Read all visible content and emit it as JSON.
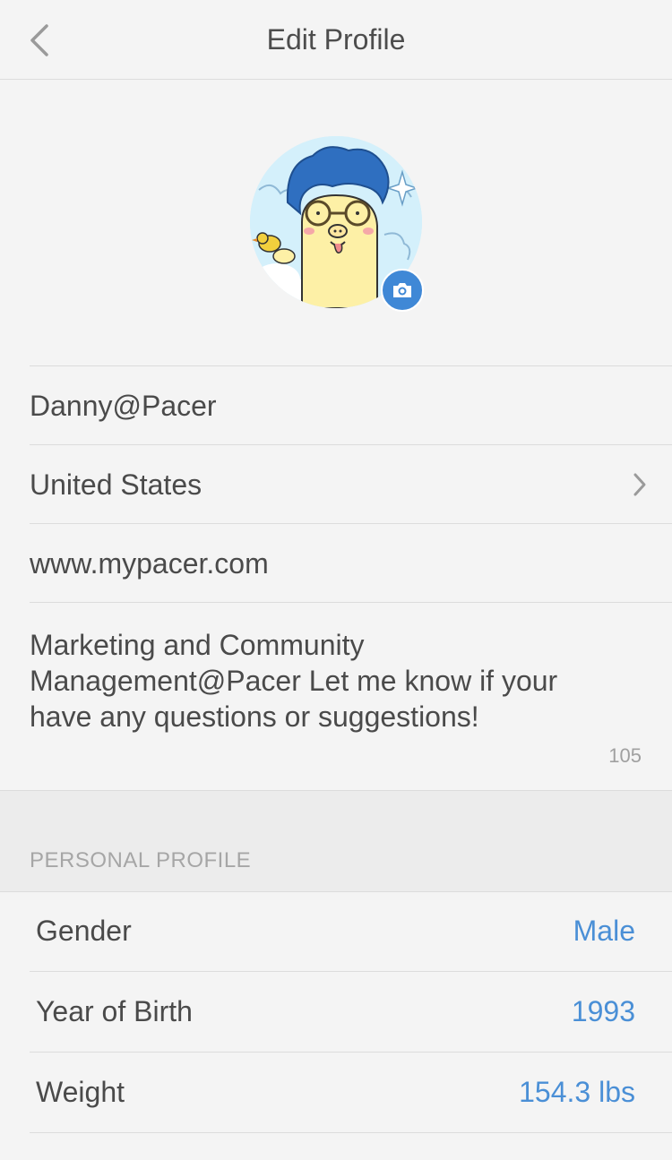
{
  "header": {
    "title": "Edit Profile",
    "back_icon": "chevron-left-icon"
  },
  "profile": {
    "avatar": "cartoon-avatar-with-glasses",
    "camera_icon": "camera-icon",
    "username": "Danny@Pacer",
    "country": "United States",
    "website": "www.mypacer.com",
    "bio": "Marketing and Community Management@Pacer Let me know if your have any questions or suggestions!",
    "bio_remaining": "105"
  },
  "personal_profile": {
    "section_title": "PERSONAL PROFILE",
    "rows": [
      {
        "label": "Gender",
        "value": "Male"
      },
      {
        "label": "Year of Birth",
        "value": "1993"
      },
      {
        "label": "Weight",
        "value": "154.3 lbs"
      }
    ]
  },
  "colors": {
    "accent": "#4a8fd6",
    "background": "#f4f4f4",
    "divider": "#dcdcdc",
    "section_band": "#ececec"
  }
}
